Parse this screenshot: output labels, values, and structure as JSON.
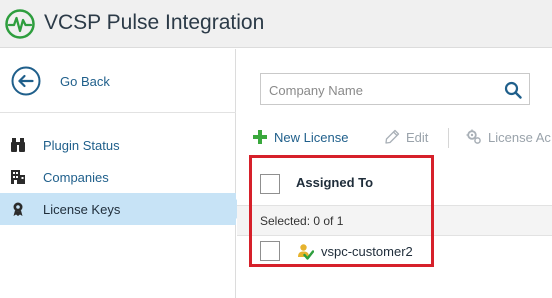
{
  "header": {
    "title": "VCSP Pulse Integration",
    "logo_icon": "pulse-icon",
    "accent_color": "#2e9e3e"
  },
  "sidebar": {
    "back_label": "Go Back",
    "items": [
      {
        "label": "Plugin Status",
        "icon": "binoculars-icon",
        "active": false
      },
      {
        "label": "Companies",
        "icon": "building-icon",
        "active": false
      },
      {
        "label": "License Keys",
        "icon": "license-key-icon",
        "active": true
      }
    ],
    "active_color": "#c7e3f6"
  },
  "search": {
    "placeholder": "Company Name",
    "value": ""
  },
  "toolbar": {
    "new_label": "New License",
    "edit_label": "Edit",
    "license_label": "License Ac"
  },
  "grid": {
    "column_header": "Assigned To",
    "selected_text": "Selected: 0 of 1",
    "rows": [
      {
        "name": "vspc-customer2",
        "checked": false
      }
    ]
  },
  "highlight": {
    "color": "#d6202a"
  }
}
